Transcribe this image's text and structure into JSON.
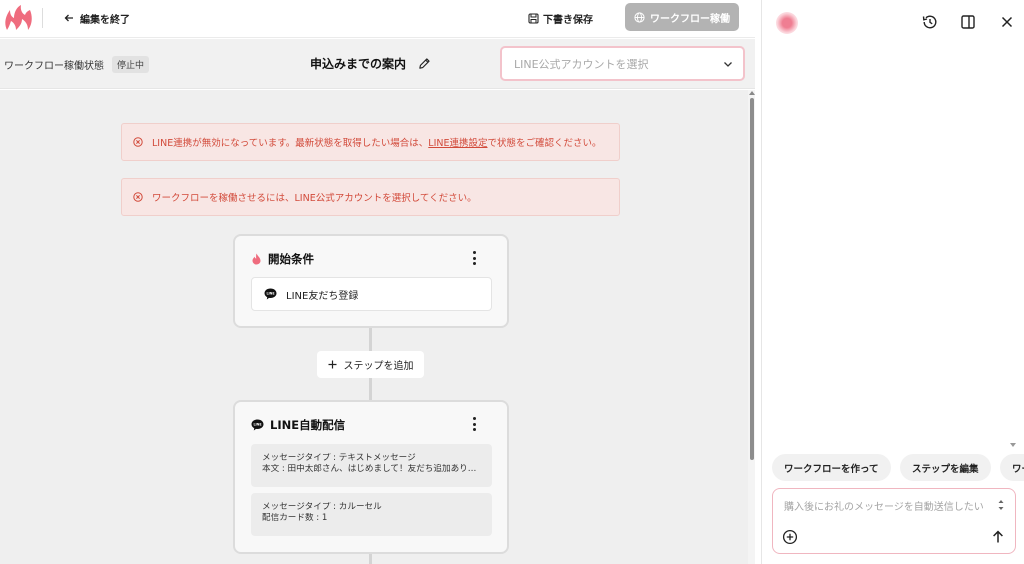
{
  "app": {
    "logo_icon": "flame-logo",
    "brand_color": "#ef6c7e"
  },
  "header": {
    "exit_label": "編集を終了",
    "save_draft_label": "下書き保存",
    "run_workflow_label": "ワークフロー稼働"
  },
  "status_bar": {
    "label": "ワークフロー稼働状態",
    "status": "停止中",
    "workflow_title": "申込みまでの案内",
    "account_select_placeholder": "LINE公式アカウントを選択"
  },
  "alerts": [
    {
      "before": "LINE連携が無効になっています。最新状態を取得したい場合は、",
      "link": "LINE連携設定",
      "after": "で状態をご確認ください。"
    },
    {
      "before": "ワークフローを稼働させるには、LINE公式アカウントを選択してください。",
      "link": "",
      "after": ""
    }
  ],
  "trigger_card": {
    "title": "開始条件",
    "item": "LINE友だち登録",
    "line_badge": "LINE"
  },
  "add_step_label": "ステップを追加",
  "delivery_card": {
    "title": "LINE自動配信",
    "line_badge": "LINE",
    "messages": [
      {
        "line1": "メッセージタイプ : テキストメッセージ",
        "line2": "本文 : 田中太郎さん、はじめまして！友だち追加ありがとうございます。"
      },
      {
        "line1": "メッセージタイプ : カルーセル",
        "line2": "配信カード数 : 1"
      }
    ]
  },
  "assistant_panel": {
    "chips": [
      "ワークフローを作って",
      "ステップを編集",
      "ワークフロー"
    ],
    "input_placeholder": "購入後にお礼のメッセージを自動送信したい"
  },
  "colors": {
    "alert_text": "#d24a3a",
    "alert_bg": "#f8e6e4",
    "run_button_disabled": "#b3b3b3",
    "select_border": "#f3c3cb"
  }
}
